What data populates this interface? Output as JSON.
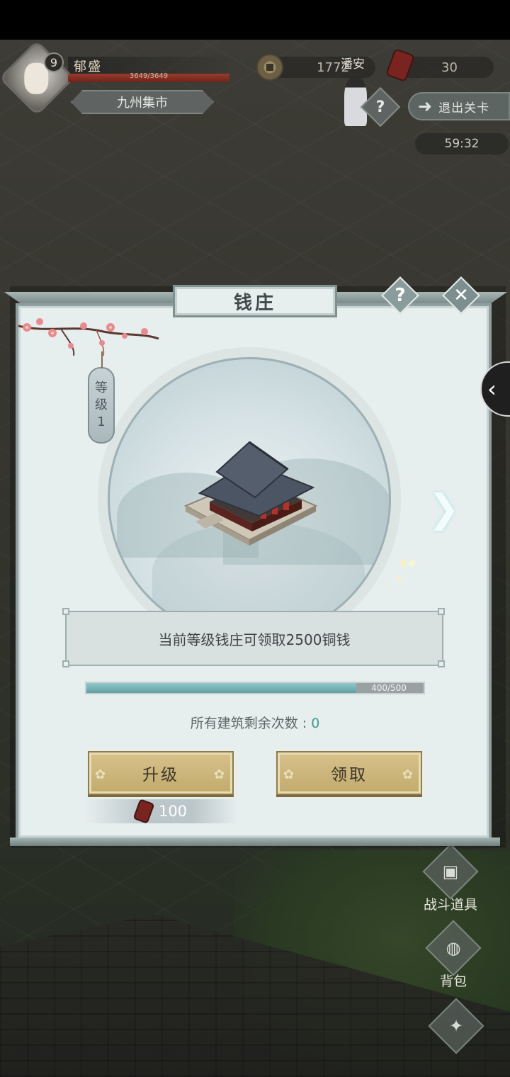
{
  "hud": {
    "player_level": "9",
    "player_name": "郁盛",
    "hp_text": "3649/3649",
    "hp_fraction": 1.0,
    "location": "九州集市",
    "coins": "1772",
    "npc_name": "潘安",
    "tokens": "30",
    "help_symbol": "?",
    "exit_label": "退出关卡",
    "timer": "59:32"
  },
  "side_menu": {
    "battle_items_label": "战斗道具",
    "bag_label": "背包"
  },
  "modal": {
    "title": "钱庄",
    "help_symbol": "?",
    "close_symbol": "✕",
    "level_tag_text": [
      "等",
      "级",
      "1"
    ],
    "description": "当前等级钱庄可领取2500铜钱",
    "progress_text": "400/500",
    "progress_fraction": 0.8,
    "remaining_label": "所有建筑剩余次数 : ",
    "remaining_count": "0",
    "upgrade_label": "升级",
    "claim_label": "领取",
    "upgrade_cost": "100"
  }
}
